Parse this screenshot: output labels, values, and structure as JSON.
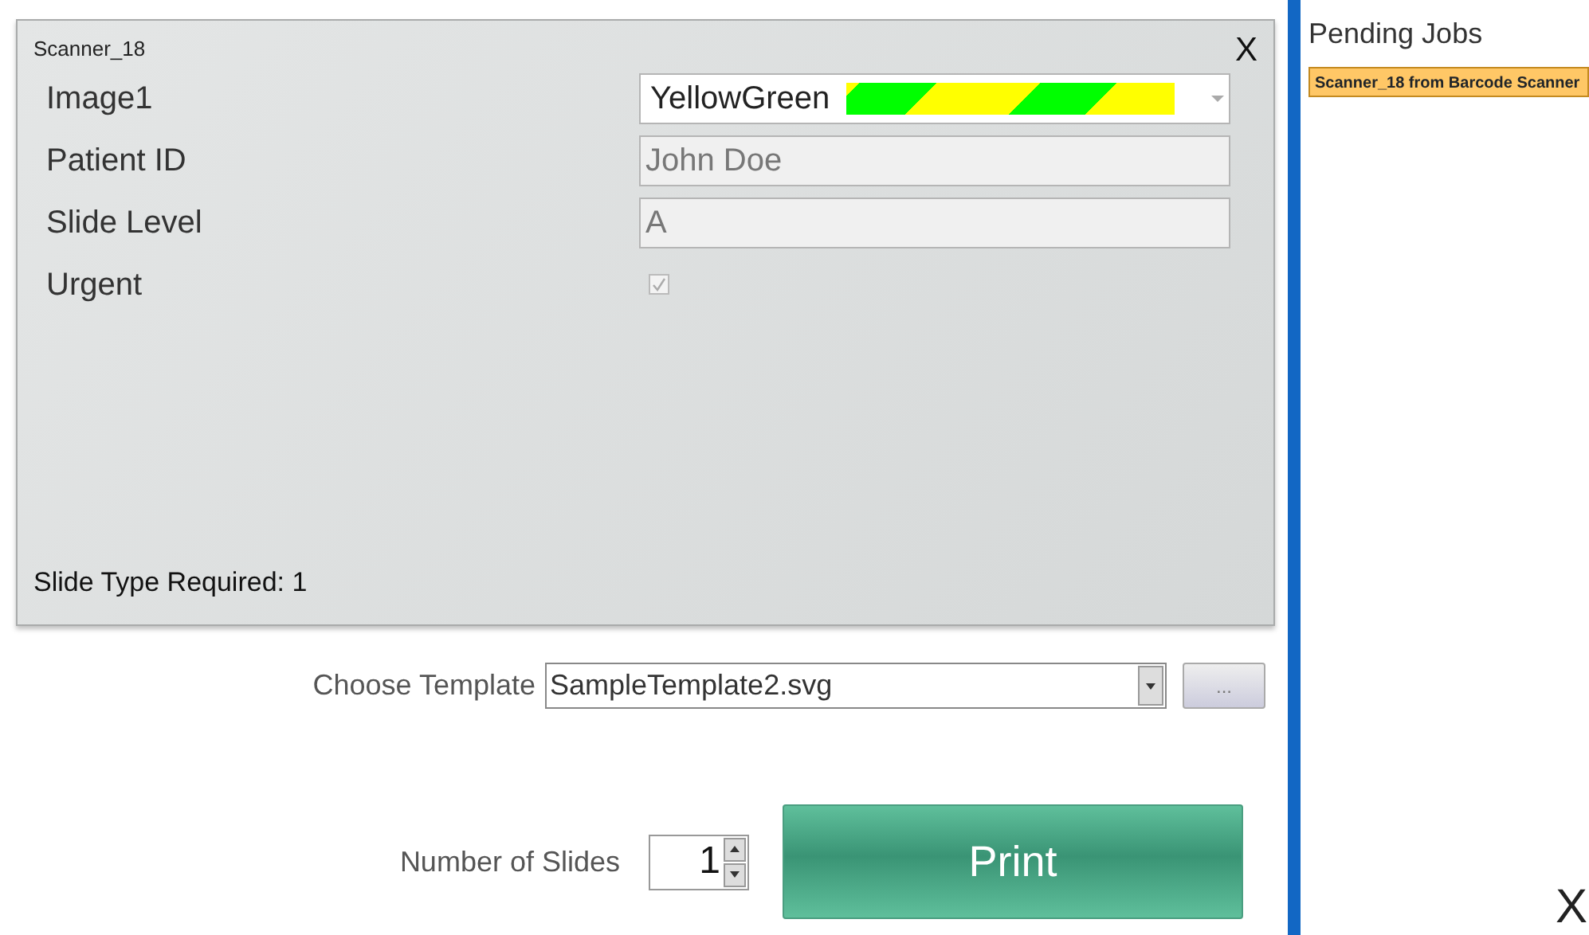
{
  "scan_panel": {
    "title": "Scanner_18",
    "close": "X",
    "fields": [
      {
        "kind": "color-select",
        "label": "Image1",
        "value": "YellowGreen"
      },
      {
        "kind": "text",
        "label": "Patient ID",
        "value": "John Doe",
        "disabled": true
      },
      {
        "kind": "text",
        "label": "Slide Level",
        "value": "A",
        "disabled": true
      },
      {
        "kind": "checkbox",
        "label": "Urgent",
        "checked": true,
        "disabled": true
      }
    ],
    "footer": "Slide Type Required: 1"
  },
  "template": {
    "label": "Choose Template",
    "value": "SampleTemplate2.svg",
    "browse": "..."
  },
  "slides": {
    "label": "Number of Slides",
    "value": "1"
  },
  "print_button": "Print",
  "pending": {
    "title": "Pending Jobs",
    "jobs": [
      {
        "label": "Scanner_18 from Barcode Scanner",
        "selected": true
      }
    ]
  },
  "close": "X"
}
